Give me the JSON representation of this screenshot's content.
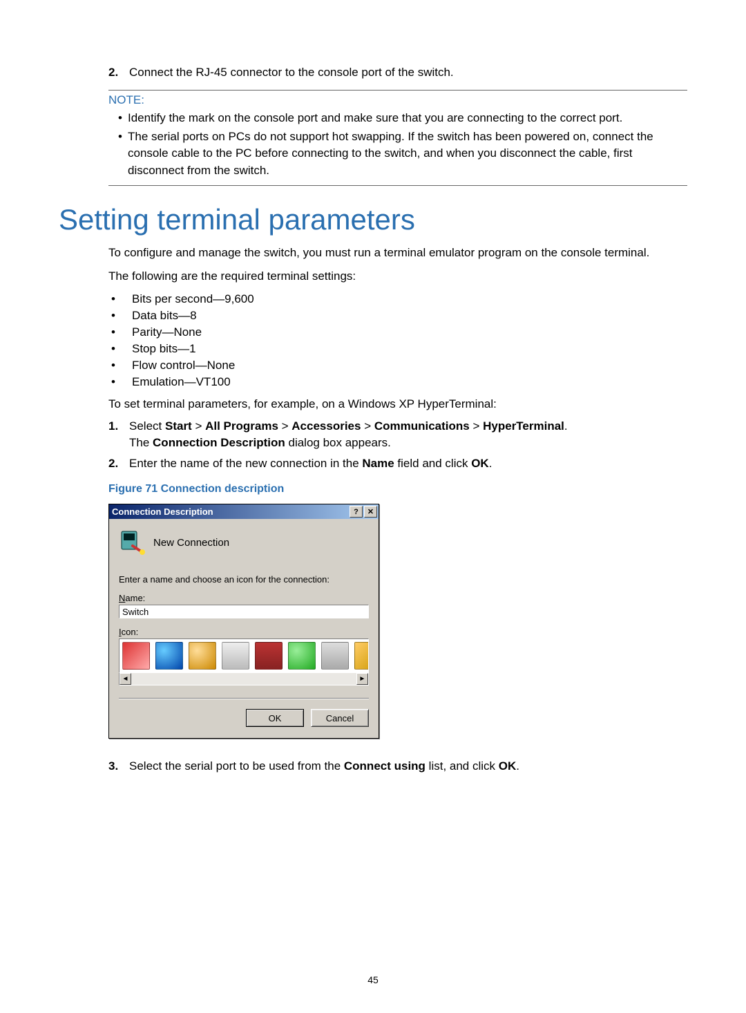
{
  "step_top": {
    "num": "2.",
    "text": "Connect the RJ-45 connector to the console port of the switch."
  },
  "note": {
    "label": "NOTE:",
    "bullets": [
      "Identify the mark on the console port and make sure that you are connecting to the correct port.",
      "The serial ports on PCs do not support hot swapping. If the switch has been powered on, connect the console cable to the PC before connecting to the switch, and when you disconnect the cable, first disconnect from the switch."
    ]
  },
  "heading": "Setting terminal parameters",
  "para1": "To configure and manage the switch, you must run a terminal emulator program on the console terminal.",
  "para2": "The following are the required terminal settings:",
  "settings": [
    "Bits per second—9,600",
    "Data bits—8",
    "Parity—None",
    "Stop bits—1",
    "Flow control—None",
    "Emulation—VT100"
  ],
  "para3": "To set terminal parameters, for example, on a Windows XP HyperTerminal:",
  "steps": [
    {
      "num": "1.",
      "pre": "Select ",
      "path": [
        "Start",
        "All Programs",
        "Accessories",
        "Communications",
        "HyperTerminal"
      ],
      "post_line": "The ",
      "post_bold": "Connection Description",
      "post_line2": " dialog box appears."
    },
    {
      "num": "2.",
      "pre": "Enter the name of the new connection in the ",
      "bold1": "Name",
      "mid": " field and click ",
      "bold2": "OK",
      "end": "."
    }
  ],
  "figure_caption": "Figure 71 Connection description",
  "dialog": {
    "title": "Connection Description",
    "help_btn": "?",
    "close_btn": "✕",
    "header": "New Connection",
    "instruction": "Enter a name and choose an icon for the connection:",
    "name_label_u": "N",
    "name_label_rest": "ame:",
    "name_value": "Switch",
    "icon_label_u": "I",
    "icon_label_rest": "con:",
    "ok": "OK",
    "cancel": "Cancel",
    "scroll_left": "◄",
    "scroll_right": "►",
    "icons": [
      {
        "name": "phone-red-icon",
        "bg": "linear-gradient(135deg,#d33,#faa)"
      },
      {
        "name": "globe-blue-icon",
        "bg": "radial-gradient(circle at 30% 30%,#6cf,#04a)"
      },
      {
        "name": "globe-cable-icon",
        "bg": "radial-gradient(circle at 30% 30%,#fd9,#c80)"
      },
      {
        "name": "computer-paper-icon",
        "bg": "linear-gradient(#eee,#bbb)"
      },
      {
        "name": "mci-badge-icon",
        "bg": "linear-gradient(#b33,#822)"
      },
      {
        "name": "globe-green-icon",
        "bg": "radial-gradient(circle at 30% 30%,#9e9,#2a2)"
      },
      {
        "name": "phone-doc-icon",
        "bg": "linear-gradient(#ddd,#aaa)"
      },
      {
        "name": "phone-gold-icon",
        "bg": "linear-gradient(135deg,#fc6,#c90)"
      }
    ]
  },
  "step3": {
    "num": "3.",
    "pre": "Select the serial port to be used from the ",
    "bold1": "Connect using",
    "mid": " list, and click ",
    "bold2": "OK",
    "end": "."
  },
  "page_number": "45"
}
